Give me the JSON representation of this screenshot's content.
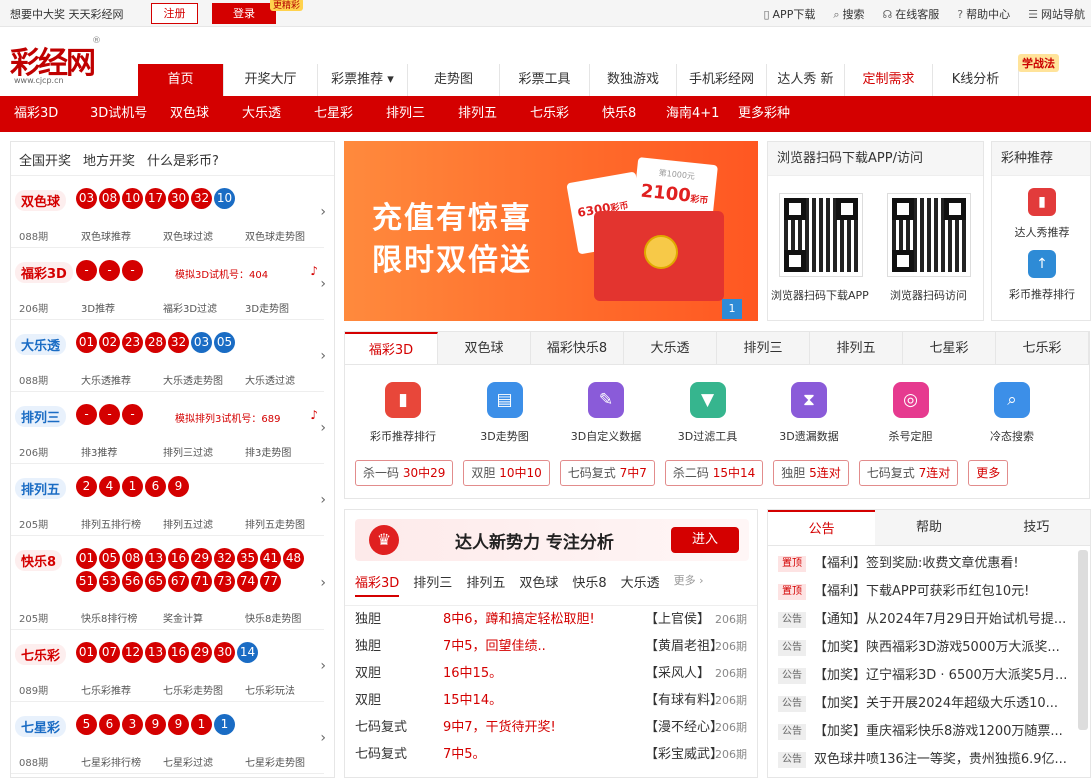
{
  "topbar": {
    "slogan": "想要中大奖 天天彩经网",
    "register": "注册",
    "login": "登录",
    "login_tag": "更精彩",
    "links": [
      {
        "icon": "phone-icon",
        "label": "APP下载"
      },
      {
        "icon": "search-icon",
        "label": "搜索"
      },
      {
        "icon": "headset-icon",
        "label": "在线客服"
      },
      {
        "icon": "help-icon",
        "label": "帮助中心"
      },
      {
        "icon": "menu-icon",
        "label": "网站导航"
      }
    ]
  },
  "logo": {
    "text": "彩经网",
    "url": "www.cjcp.cn",
    "reg": "®"
  },
  "mainnav": [
    {
      "label": "首页",
      "w": 86
    },
    {
      "label": "开奖大厅",
      "w": 94
    },
    {
      "label": "彩票推荐 ▾",
      "w": 90
    },
    {
      "label": "走势图",
      "w": 92
    },
    {
      "label": "彩票工具",
      "w": 90
    },
    {
      "label": "数独游戏",
      "w": 87
    },
    {
      "label": "手机彩经网",
      "w": 90
    },
    {
      "label": "达人秀 新",
      "w": 78
    },
    {
      "label": "定制需求",
      "w": 88
    },
    {
      "label": "K线分析",
      "w": 86
    }
  ],
  "mainnav_tag": "学战法",
  "subnav": [
    "福彩3D",
    "3D试机号",
    "双色球",
    "大乐透",
    "七星彩",
    "排列三",
    "排列五",
    "七乐彩",
    "快乐8",
    "海南4+1",
    "更多彩种"
  ],
  "left": {
    "tabs": [
      "全国开奖",
      "地方开奖",
      "什么是彩币?"
    ],
    "rows": [
      {
        "name": "双色球",
        "blue": false,
        "issue": "088期",
        "balls": [
          "03",
          "08",
          "10",
          "17",
          "30",
          "32"
        ],
        "bballs": [
          "10"
        ],
        "links": [
          "双色球推荐",
          "双色球过滤",
          "双色球走势图"
        ]
      },
      {
        "name": "福彩3D",
        "blue": false,
        "issue": "206期",
        "balls": [
          "-",
          "-",
          "-"
        ],
        "bballs": [],
        "sim": "模拟3D试机号：404",
        "links": [
          "3D推荐",
          "福彩3D过滤",
          "3D走势图"
        ]
      },
      {
        "name": "大乐透",
        "blue": true,
        "issue": "088期",
        "balls": [
          "01",
          "02",
          "23",
          "28",
          "32"
        ],
        "bballs": [
          "03",
          "05"
        ],
        "links": [
          "大乐透推荐",
          "大乐透走势图",
          "大乐透过滤"
        ]
      },
      {
        "name": "排列三",
        "blue": true,
        "issue": "206期",
        "balls": [
          "-",
          "-",
          "-"
        ],
        "bballs": [],
        "sim": "模拟排列3试机号：689",
        "links": [
          "排3推荐",
          "排列三过滤",
          "排3走势图"
        ]
      },
      {
        "name": "排列五",
        "blue": true,
        "issue": "205期",
        "balls": [
          "2",
          "4",
          "1",
          "6",
          "9"
        ],
        "bballs": [],
        "links": [
          "排列五排行榜",
          "排列五过滤",
          "排列五走势图"
        ]
      },
      {
        "name": "快乐8",
        "blue": false,
        "issue": "205期",
        "balls": [
          "01",
          "05",
          "08",
          "13",
          "16",
          "29",
          "32",
          "35",
          "41",
          "48",
          "51",
          "53",
          "56",
          "65",
          "67",
          "71",
          "73",
          "74",
          "77"
        ],
        "bballs": [],
        "links": [
          "快乐8排行榜",
          "奖金计算",
          "快乐8走势图"
        ]
      },
      {
        "name": "七乐彩",
        "blue": false,
        "issue": "089期",
        "balls": [
          "01",
          "07",
          "12",
          "13",
          "16",
          "29",
          "30"
        ],
        "bballs": [
          "14"
        ],
        "links": [
          "七乐彩推荐",
          "七乐彩走势图",
          "七乐彩玩法"
        ]
      },
      {
        "name": "七星彩",
        "blue": true,
        "issue": "088期",
        "balls": [
          "5",
          "6",
          "3",
          "9",
          "9",
          "1"
        ],
        "bballs": [
          "1"
        ],
        "links": [
          "七星彩排行榜",
          "七星彩过滤",
          "七星彩走势图"
        ]
      }
    ]
  },
  "banner": {
    "line1": "充值有惊喜",
    "line2": "限时双倍送",
    "card1": "6300",
    "card1_sub": "彩币",
    "card2": "2100",
    "card2_sub": "彩币",
    "card2_top": "第1000元",
    "page": "1"
  },
  "qr": {
    "title": "浏览器扫码下载APP/访问",
    "label1": "浏览器扫码下载APP",
    "label2": "浏览器扫码访问"
  },
  "rec": {
    "title": "彩种推荐",
    "items": [
      {
        "label": "达人秀推荐",
        "color": "#e23b3b",
        "icon": "bookmark-icon"
      },
      {
        "label": "彩币推荐排行",
        "color": "#2e8bd6",
        "icon": "up-arrow-icon"
      }
    ]
  },
  "games": {
    "tabs": [
      "福彩3D",
      "双色球",
      "福彩快乐8",
      "大乐透",
      "排列三",
      "排列五",
      "七星彩",
      "七乐彩"
    ],
    "tools": [
      {
        "label": "彩币推荐排行",
        "color": "#e8473a",
        "glyph": "▮"
      },
      {
        "label": "3D走势图",
        "color": "#3c8fe8",
        "glyph": "▤"
      },
      {
        "label": "3D自定义数据",
        "color": "#8a5bd9",
        "glyph": "✎"
      },
      {
        "label": "3D过滤工具",
        "color": "#36b58e",
        "glyph": "▼"
      },
      {
        "label": "3D遗漏数据",
        "color": "#8a5bd9",
        "glyph": "⧗"
      },
      {
        "label": "杀号定胆",
        "color": "#e63a8f",
        "glyph": "◎"
      },
      {
        "label": "冷态搜索",
        "color": "#3c8fe8",
        "glyph": "⌕"
      }
    ],
    "chips": [
      {
        "a": "杀一码",
        "b": "30中29"
      },
      {
        "a": "双胆",
        "b": "10中10"
      },
      {
        "a": "七码复式",
        "b": "7中7"
      },
      {
        "a": "杀二码",
        "b": "15中14"
      },
      {
        "a": "独胆",
        "b": "5连对"
      },
      {
        "a": "七码复式",
        "b": "7连对"
      }
    ],
    "more": "更多"
  },
  "expert": {
    "title": "达人新势力 专注分析",
    "go": "进入",
    "tabs": [
      "福彩3D",
      "排列三",
      "排列五",
      "双色球",
      "快乐8",
      "大乐透"
    ],
    "more": "更多 ›",
    "rows": [
      {
        "k": "独胆",
        "v": "8中6，蹲和搞定轻松取胆!",
        "a": "【上官侯】",
        "p": "206期"
      },
      {
        "k": "独胆",
        "v": "7中5，回望佳绩..",
        "a": "【黄眉老祖】",
        "p": "206期"
      },
      {
        "k": "双胆",
        "v": "16中15。",
        "a": "【采风人】",
        "p": "206期"
      },
      {
        "k": "双胆",
        "v": "15中14。",
        "a": "【有球有料】",
        "p": "206期"
      },
      {
        "k": "七码复式",
        "v": "9中7，干货待开奖!",
        "a": "【漫不经心】",
        "p": "206期"
      },
      {
        "k": "七码复式",
        "v": "7中5。",
        "a": "【彩宝威武】",
        "p": "206期"
      }
    ]
  },
  "notice": {
    "tabs": [
      "公告",
      "帮助",
      "技巧"
    ],
    "rows": [
      {
        "b": "置顶",
        "top": true,
        "t": "【福利】签到奖励:收费文章优惠看!"
      },
      {
        "b": "置顶",
        "top": true,
        "t": "【福利】下载APP可获彩币红包10元!"
      },
      {
        "b": "公告",
        "top": false,
        "t": "【通知】从2024年7月29日开始试机号提..."
      },
      {
        "b": "公告",
        "top": false,
        "t": "【加奖】陕西福彩3D游戏5000万大派奖..."
      },
      {
        "b": "公告",
        "top": false,
        "t": "【加奖】辽宁福彩3D · 6500万大派奖5月..."
      },
      {
        "b": "公告",
        "top": false,
        "t": "【加奖】关于开展2024年超级大乐透10..."
      },
      {
        "b": "公告",
        "top": false,
        "t": "【加奖】重庆福彩快乐8游戏1200万随票..."
      },
      {
        "b": "公告",
        "top": false,
        "t": "双色球井喷136注一等奖，贵州独揽6.9亿..."
      }
    ]
  }
}
